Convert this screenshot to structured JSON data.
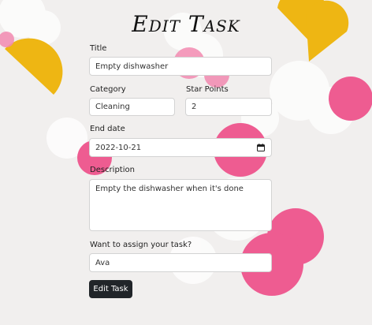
{
  "page": {
    "title": "Edit Task"
  },
  "form": {
    "title": {
      "label": "Title",
      "value": "Empty dishwasher"
    },
    "category": {
      "label": "Category",
      "value": "Cleaning"
    },
    "star_points": {
      "label": "Star Points",
      "value": "2"
    },
    "end_date": {
      "label": "End date",
      "value": "2022-10-21"
    },
    "description": {
      "label": "Description",
      "value": "Empty the dishwasher when it's done"
    },
    "assign": {
      "label": "Want to assign your task?",
      "value": "Ava"
    },
    "submit_label": "Edit Task"
  },
  "icons": {
    "calendar": "calendar-icon"
  },
  "colors": {
    "button_bg": "#212529",
    "confetti_pink": "#ee5c91",
    "confetti_yellow": "#eeb613"
  }
}
